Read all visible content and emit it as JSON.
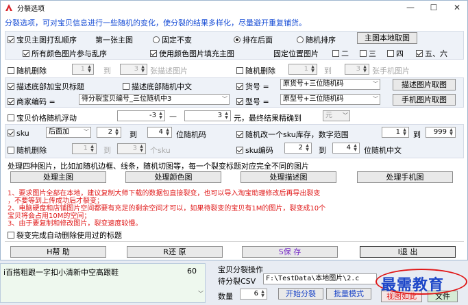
{
  "window": {
    "title": "分裂选项",
    "min": "—",
    "max": "☐",
    "close": "✕"
  },
  "hint": "分裂选项，可对宝贝信息进行一些随机的变化，使分裂的结果多样化，尽量避开重复铺货。",
  "row1": {
    "check": "宝贝主图打乱顺序",
    "first": "第一张主图",
    "opt1": "固定不变",
    "opt2": "排在后面",
    "opt3": "随机排序",
    "btn": "主图本地取图"
  },
  "row2": {
    "all_color": "所有颜色图片参与乱序",
    "use_color": "使用颜色图片填充主图",
    "fixed": "固定位置图片",
    "p2": "二",
    "p3": "三",
    "p4": "四",
    "p56": "五、六"
  },
  "row3": {
    "rand_del": "随机删除",
    "v1": "1",
    "to": "到",
    "v2": "3",
    "unit_desc": "张描述图片",
    "rand_del2": "随机删除",
    "v3": "1",
    "to2": "到",
    "v4": "3",
    "unit_phone": "张手机图片"
  },
  "row4": {
    "desc_add": "描述底部加宝贝标题",
    "desc_rand": "描述底部随机中文",
    "huohao": "货号 =",
    "huohao_val": "原货号+三位随机码",
    "btn": "描述图片取图"
  },
  "row5": {
    "merchant": "商家编码 =",
    "merchant_val": "待分裂宝贝编号_三位随机中3",
    "model": "型号 =",
    "model_val": "原型号+三位随机码",
    "btn": "手机图片取图"
  },
  "row6": {
    "price": "宝贝价格随机浮动",
    "v1": "-3",
    "dash": "—",
    "v2": "3",
    "unit": "元，最终结果精确到",
    "prec": "元"
  },
  "row7": {
    "sku": "sku",
    "pos": "后面加",
    "v1": "2",
    "to": "到",
    "v2": "4",
    "unit": "位随机码",
    "stock": "随机改一个sku库存，数字范围",
    "s1": "1",
    "to2": "到",
    "s2": "999"
  },
  "row8": {
    "rand_del": "随机删除",
    "v1": "1",
    "to": "到",
    "v2": "3",
    "unit": "个sku",
    "skucode": "sku编码",
    "c1": "2",
    "to2": "到",
    "c2": "4",
    "unit2": "位随机中文"
  },
  "process": {
    "text": "处理四种图片，比如加随机边框、线条，随机切图等，每一个裂变标题对应完全不同的图片",
    "b1": "处理主图",
    "b2": "处理颜色图",
    "b3": "处理描述图",
    "b4": "处理手机图"
  },
  "notes": {
    "n1": "1、要求图片全部在本地，建议复制大师下载的数据包直接裂变，也可以导入淘宝助理修改后再导出裂变",
    "n1b": "，不要等到上传成功后才裂变；",
    "n2": "2、电脑硬盘和店铺图片空间都要有充足的剩余空间才可以，如果待裂变的宝贝有1M的图片，裂变成10个",
    "n2b": "宝贝将会占用10M的空间；",
    "n3": "3、由于要复制和修改图片，裂变速度较慢。"
  },
  "auto_delete": "裂变完成自动删除使用过的标题",
  "footer": {
    "help": "H帮  助",
    "restore": "R还  原",
    "save": "S保  存",
    "exit": "I退  出"
  },
  "bottom": {
    "list_item": "i百搭粗跟一字扣小清新中空高跟鞋",
    "list_count": "60",
    "group": "宝贝分裂操作",
    "csv_label": "待分裂CSV",
    "csv_path": "F:\\TestData\\本地图片\\2.c",
    "qty_label": "数量",
    "qty": "6",
    "start": "开始分裂",
    "batch": "批量模式",
    "sim": "视图如此",
    "file": "文件"
  },
  "logo": "最需教育"
}
